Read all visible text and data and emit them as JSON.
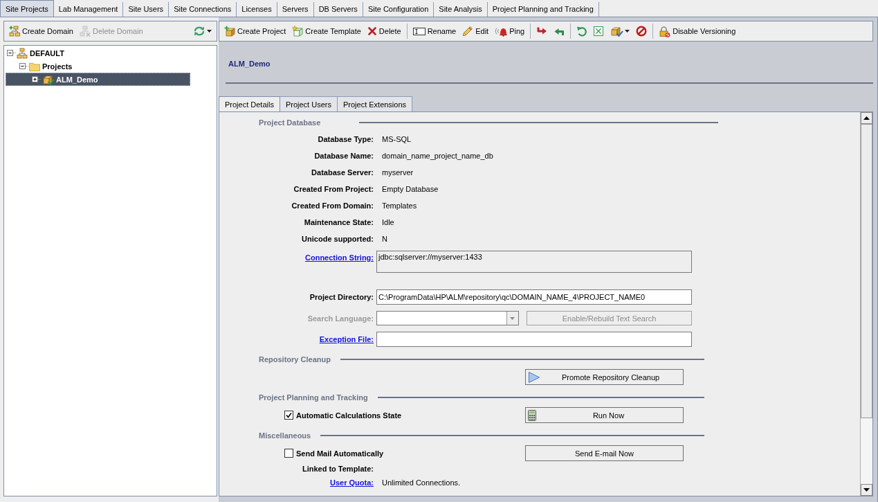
{
  "main_tabs": [
    {
      "label": "Site Projects",
      "selected": true
    },
    {
      "label": "Lab Management",
      "selected": false
    },
    {
      "label": "Site Users",
      "selected": false
    },
    {
      "label": "Site Connections",
      "selected": false
    },
    {
      "label": "Licenses",
      "selected": false
    },
    {
      "label": "Servers",
      "selected": false
    },
    {
      "label": "DB Servers",
      "selected": false
    },
    {
      "label": "Site Configuration",
      "selected": false
    },
    {
      "label": "Site Analysis",
      "selected": false
    },
    {
      "label": "Project Planning and Tracking",
      "selected": false
    }
  ],
  "domain_toolbar": {
    "items": [
      {
        "kind": "button",
        "label": "Create Domain",
        "disabled": false
      },
      {
        "kind": "button",
        "label": "Delete Domain",
        "disabled": true
      },
      {
        "kind": "menu",
        "disabled": false
      }
    ]
  },
  "domain_tree": {
    "items": [
      {
        "label": "DEFAULT",
        "expanded": true,
        "selected": false,
        "children": [
          {
            "label": "Projects",
            "expanded": true,
            "selected": false,
            "children": [
              {
                "label": "ALM_Demo",
                "expanded": false,
                "selected": true
              }
            ]
          }
        ]
      }
    ]
  },
  "project_toolbar": {
    "items": [
      {
        "kind": "button",
        "label": "Create Project"
      },
      {
        "kind": "button",
        "label": "Create Template"
      },
      {
        "kind": "button",
        "label": "Delete"
      },
      {
        "kind": "separator"
      },
      {
        "kind": "button",
        "label": "Rename"
      },
      {
        "kind": "button",
        "label": "Edit"
      },
      {
        "kind": "button",
        "label": "Ping"
      },
      {
        "kind": "separator"
      },
      {
        "kind": "icon"
      },
      {
        "kind": "icon"
      },
      {
        "kind": "separator"
      },
      {
        "kind": "icon"
      },
      {
        "kind": "icon"
      },
      {
        "kind": "menu"
      },
      {
        "kind": "icon"
      },
      {
        "kind": "separator"
      },
      {
        "kind": "button",
        "label": "Disable Versioning"
      }
    ]
  },
  "project_header": {
    "title": "ALM_Demo"
  },
  "detail_tabs": [
    {
      "label": "Project Details",
      "selected": true
    },
    {
      "label": "Project Users",
      "selected": false
    },
    {
      "label": "Project Extensions",
      "selected": false
    }
  ],
  "form": {
    "sections": [
      {
        "title": "Project Database",
        "rows": [
          {
            "kind": "text",
            "label": "Database Type:",
            "value": "MS-SQL",
            "link": false,
            "disabled": false
          },
          {
            "kind": "text",
            "label": "Database Name:",
            "value": "domain_name_project_name_db",
            "link": false,
            "disabled": false
          },
          {
            "kind": "text",
            "label": "Database Server:",
            "value": "myserver",
            "link": false,
            "disabled": false
          },
          {
            "kind": "text",
            "label": "Created From Project:",
            "value": "Empty Database",
            "link": false,
            "disabled": false
          },
          {
            "kind": "text",
            "label": "Created From Domain:",
            "value": "Templates",
            "link": false,
            "disabled": false
          },
          {
            "kind": "text",
            "label": "Maintenance State:",
            "value": "Idle",
            "link": false,
            "disabled": false
          },
          {
            "kind": "text",
            "label": "Unicode supported:",
            "value": "N",
            "link": false,
            "disabled": false
          },
          {
            "kind": "textarea",
            "label": "Connection String:",
            "value": "jdbc:sqlserver://myserver:1433",
            "link": true,
            "disabled": false
          },
          {
            "kind": "input",
            "label": "Project Directory:",
            "value": "C:\\ProgramData\\HP\\ALM\\repository\\qc\\DOMAIN_NAME_4\\PROJECT_NAME0",
            "link": false,
            "disabled": false
          },
          {
            "kind": "select",
            "label": "Search Language:",
            "link": false,
            "disabled": true,
            "button": {
              "label": "Enable/Rebuild Text Search"
            }
          },
          {
            "kind": "input",
            "label": "Exception File:",
            "link": true,
            "disabled": false
          }
        ]
      },
      {
        "title": "Repository Cleanup",
        "rows": [
          {
            "kind": "action",
            "disabled": false,
            "button": {
              "label": "Promote Repository Cleanup"
            }
          }
        ]
      },
      {
        "title": "Project Planning and Tracking",
        "rows": [
          {
            "kind": "checkbox",
            "label": "Automatic Calculations State",
            "checked": true,
            "disabled": false,
            "button": {
              "label": "Run Now"
            }
          }
        ]
      },
      {
        "title": "Miscellaneous",
        "rows": [
          {
            "kind": "checkbox",
            "label": "Send Mail Automatically",
            "checked": false,
            "disabled": false,
            "button": {
              "label": "Send E-mail Now"
            }
          },
          {
            "kind": "text",
            "label": "Linked to Template:",
            "link": false,
            "disabled": false
          },
          {
            "kind": "text",
            "label": "User Quota:",
            "value": "Unlimited Connections.",
            "link": true,
            "disabled": false
          }
        ]
      }
    ]
  }
}
